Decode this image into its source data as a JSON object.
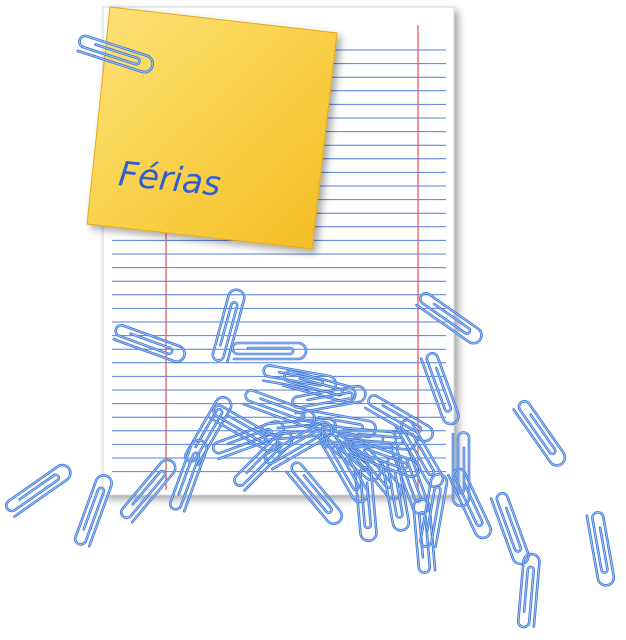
{
  "note": {
    "text": "Férias"
  },
  "colors": {
    "background": "#ffffff",
    "paper": "#ffffff",
    "paper_line": "#4f7fe0",
    "margin_line": "#e05050",
    "note_fill": "#f7c735",
    "note_highlight": "#fde27a",
    "note_text": "#2f5fd0",
    "clip_stroke": "#3f78d8"
  },
  "paper_clips": {
    "count": 40,
    "icon": "paper-clip-icon"
  }
}
